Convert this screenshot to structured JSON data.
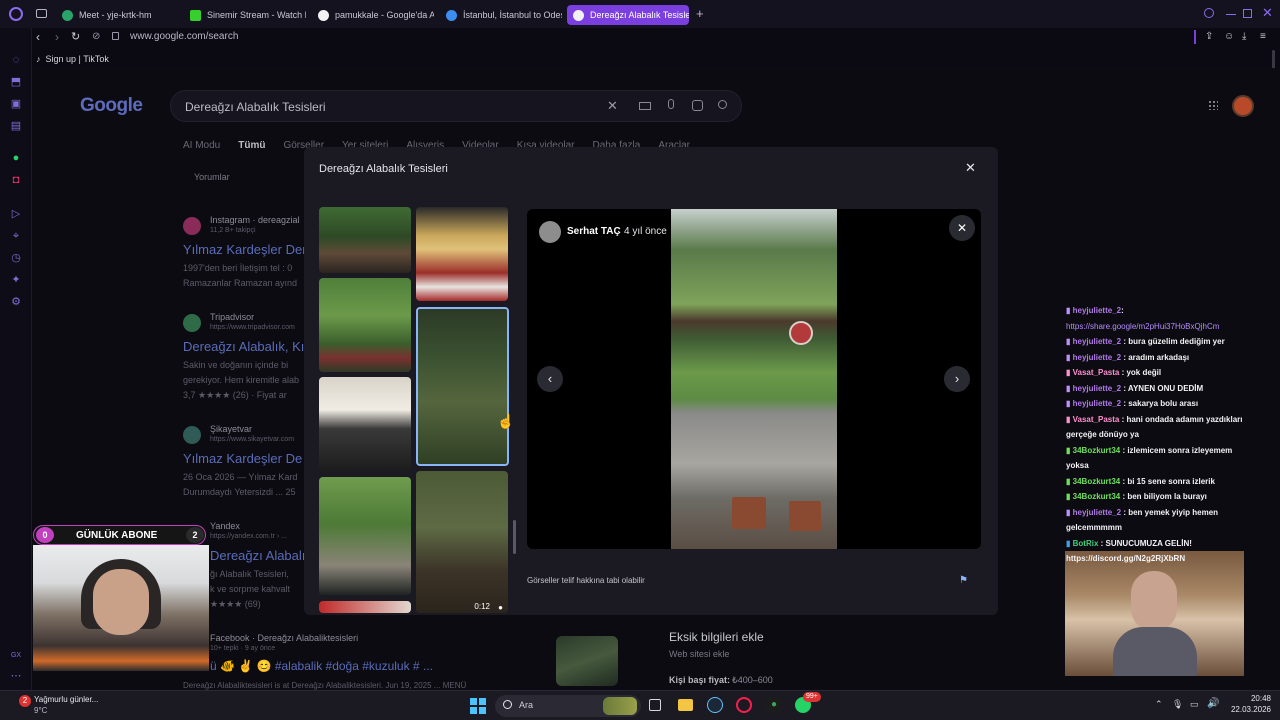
{
  "browser": {
    "tabs": [
      {
        "label": "Meet - yje-krtk-hm",
        "fav": "#29a36a"
      },
      {
        "label": "Sinemir Stream - Watch Li",
        "fav": "#35d02b"
      },
      {
        "label": "pamukkale - Google'da Ar",
        "fav": "#f2f2f2"
      },
      {
        "label": "İstanbul, İstanbul to Odes",
        "fav": "#3b8ef0"
      },
      {
        "label": "Dereağzı Alabalık Tesisleri",
        "fav": "#f2f2f2"
      }
    ],
    "url": "www.google.com/search",
    "bookmark": "Sign up | TikTok"
  },
  "google": {
    "logo": "Google",
    "query": "Dereağzı Alabalık Tesisleri",
    "nav": [
      "AI Modu",
      "Tümü",
      "Görseller",
      "Yer siteleri",
      "Alışveriş",
      "Videolar",
      "Kısa videolar",
      "Daha fazla",
      "Araçlar"
    ],
    "subtab": "Yorumlar",
    "results": [
      {
        "source": "Instagram · dereagzial",
        "meta": "11,2 B+ takipçi",
        "title": "Yılmaz Kardeşler Der",
        "snippet1": "1997'den beri İletişim tel : 0",
        "snippet2": "Ramazanlar Ramazan ayınd"
      },
      {
        "source": "Tripadvisor",
        "meta": "https://www.tripadvisor.com",
        "title": "Dereağzı Alabalık, Kı",
        "snippet1": "Sakin ve doğanın içinde bi",
        "snippet2": "gerekiyor. Hem kiremitle alab",
        "rating": "3,7 ★★★★ (26) · Fiyat ar"
      },
      {
        "source": "Şikayetvar",
        "meta": "https://www.sikayetvar.com",
        "title": "Yılmaz Kardeşler De",
        "snippet1": "26 Oca 2026 — Yılmaz Kard",
        "snippet2": "Durumdaydı Yetersizdi ... 25"
      },
      {
        "source": "Yandex",
        "meta": "https://yandex.com.tr › ...",
        "title": "Dereağzı Alabalık Te",
        "snippet1": "ğı Alabalık Tesisleri,",
        "snippet2": "k ve sorpme kahvalt",
        "rating": "★★★★ (69)"
      },
      {
        "source": "Facebook · Dereağzı Alabaliktesisleri",
        "meta": "10+ tepki · 9 ay önce",
        "title": "ü 🐠 ✌ 😊 #alabalik #doğa #kuzuluk # ...",
        "snippet1": "Dereağzı Alabaliktesisleri is at Dereağzı Alabaliktesisleri. Jun 19, 2025 ... MENÜ"
      }
    ],
    "side": {
      "heading": "Eksik bilgileri ekle",
      "link": "Web sitesi ekle",
      "price_label": "Kişi başı fiyat:",
      "price": "₺400–600"
    }
  },
  "viewer": {
    "title": "Dereağzı Alabalık Tesisleri",
    "author": "Serhat TAÇ",
    "time": "4 yıl önce",
    "copyright": "Görseller telif hakkına tabi olabilir",
    "video_duration": "0:12"
  },
  "overlay_widget": {
    "label": "GÜNLÜK ABONE",
    "left_count": "0",
    "right_count": "2"
  },
  "chat": [
    {
      "user": "heyjuliette_2",
      "cls": "u1",
      "msg": "",
      "link": "https://share.google/m2pHui37HoBxQjhCm"
    },
    {
      "user": "heyjuliette_2",
      "cls": "u1",
      "msg": "bura güzelim dediğim yer"
    },
    {
      "user": "heyjuliette_2",
      "cls": "u1",
      "msg": "aradım arkadaşı"
    },
    {
      "user": "Vasat_Pasta",
      "cls": "u2",
      "msg": "yok değil"
    },
    {
      "user": "heyjuliette_2",
      "cls": "u1",
      "msg": "AYNEN ONU DEDİM"
    },
    {
      "user": "heyjuliette_2",
      "cls": "u1",
      "msg": "sakarya bolu arası"
    },
    {
      "user": "Vasat_Pasta",
      "cls": "u2",
      "msg": "hani ondada adamın yazdıkları gerçeğe dönüyo ya"
    },
    {
      "user": "34Bozkurt34",
      "cls": "u3",
      "msg": "izlemicem sonra izleyemem yoksa"
    },
    {
      "user": "34Bozkurt34",
      "cls": "u3",
      "msg": "bi 15 sene sonra izlerik"
    },
    {
      "user": "34Bozkurt34",
      "cls": "u3",
      "msg": "ben biliyom la burayı"
    },
    {
      "user": "heyjuliette_2",
      "cls": "u1",
      "msg": "ben yemek yiyip hemen gelcemmmmm"
    },
    {
      "user": "BotRix",
      "cls": "u4",
      "msg": "SUNUCUMUZA GELİN! https://discord.gg/N2g2RjXbRN"
    }
  ],
  "taskbar": {
    "weather": "Yağmurlu günler...",
    "temp": "9°C",
    "search": "Ara",
    "time": "20:48",
    "date": "22.03.2026",
    "badge": "99+",
    "notif": "2"
  }
}
